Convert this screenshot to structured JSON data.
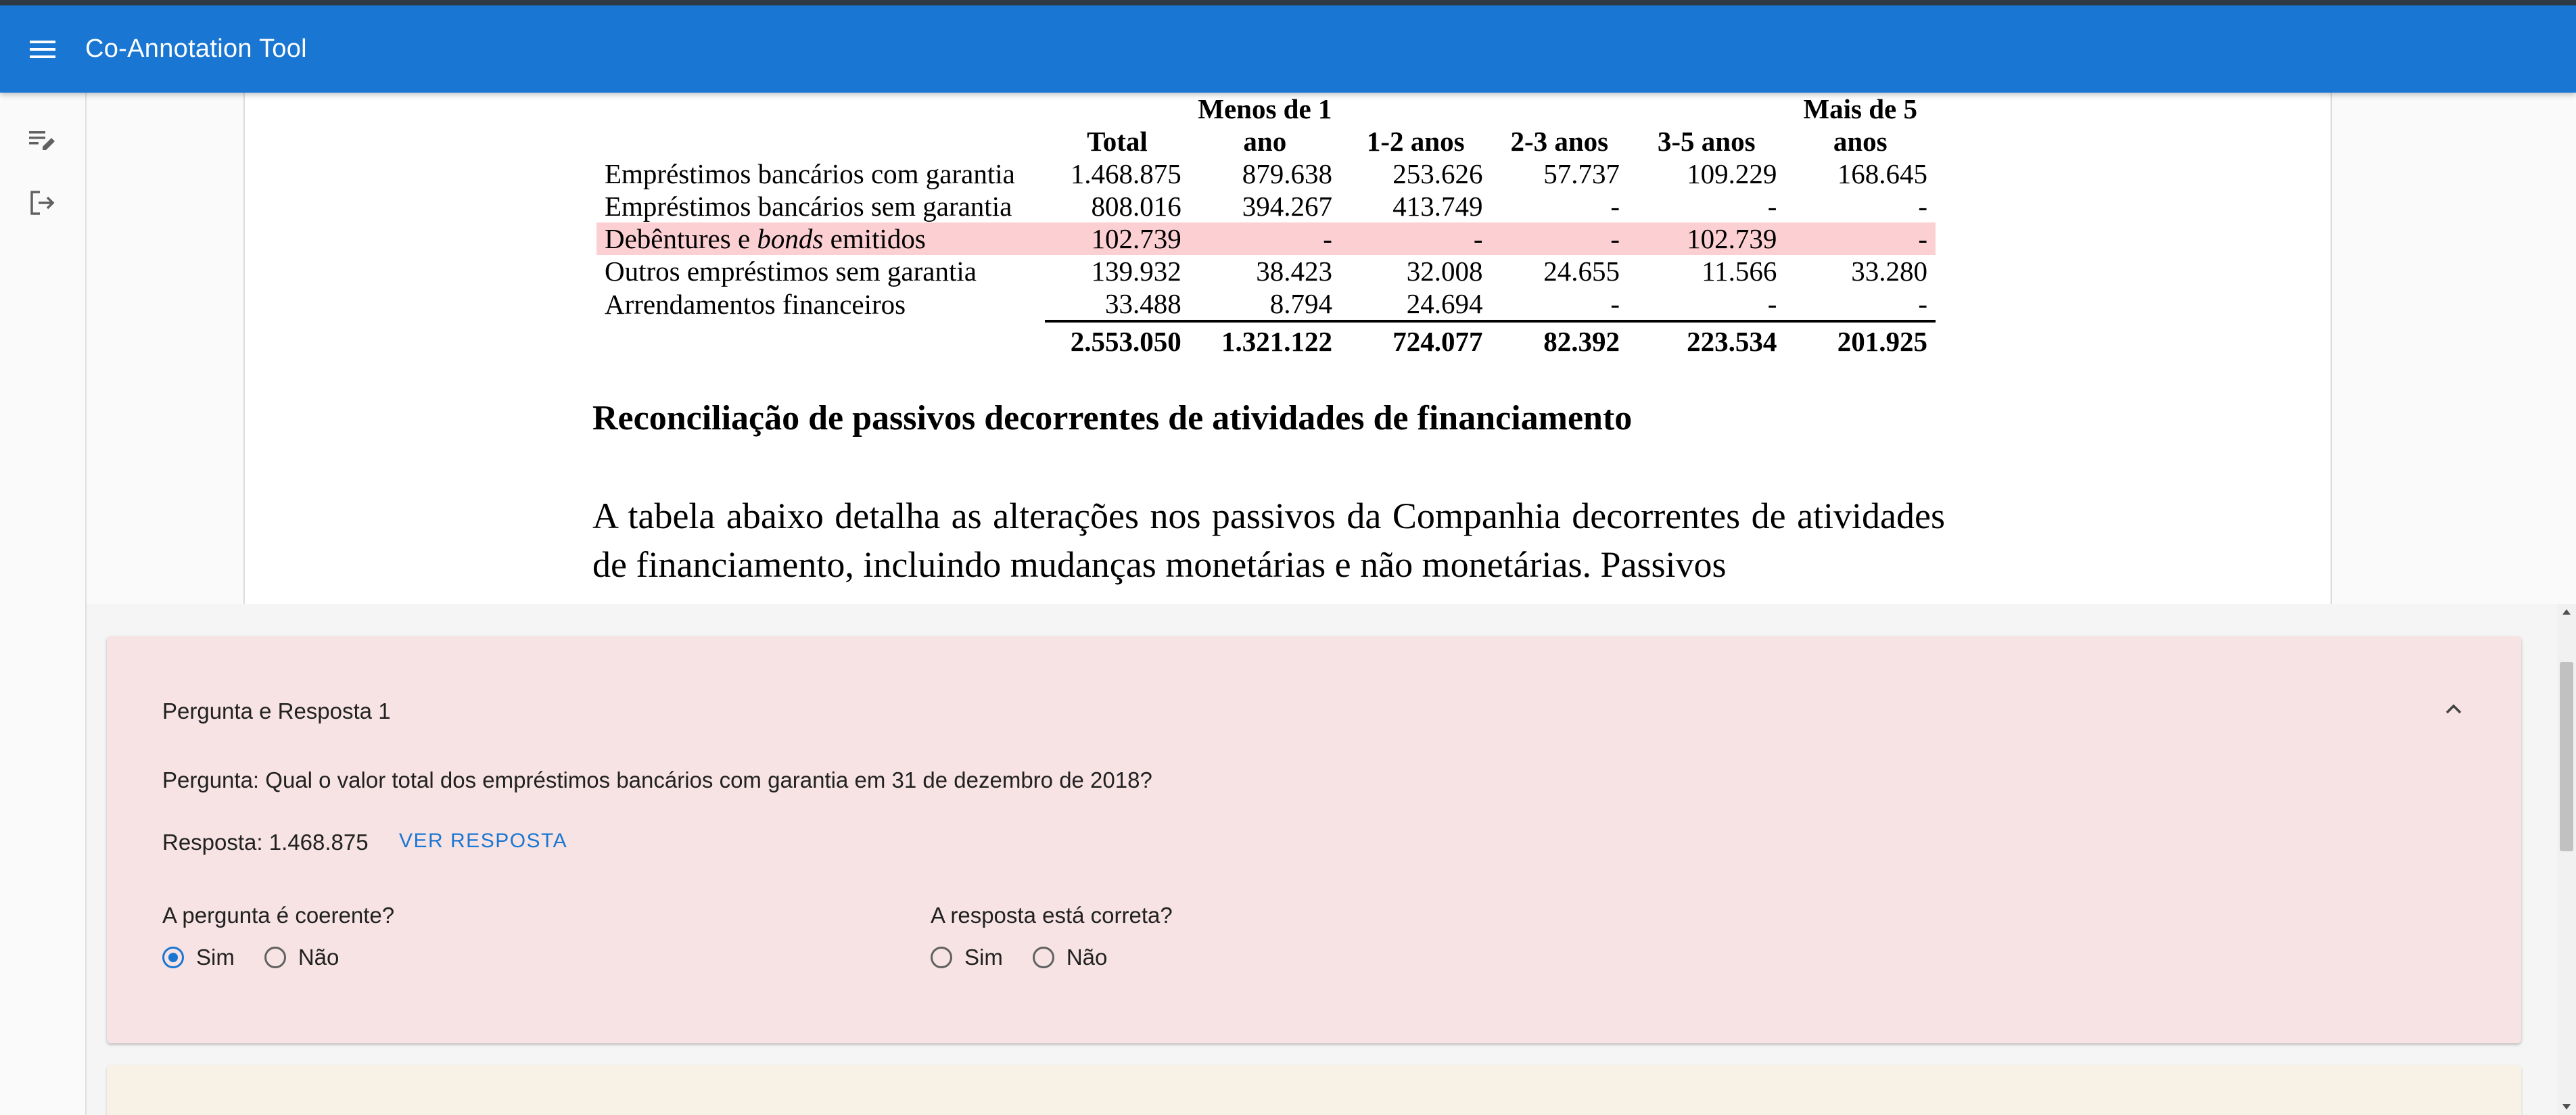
{
  "app": {
    "title": "Co-Annotation Tool"
  },
  "icons": {
    "menu": "menu-icon",
    "edit": "edit-list-icon",
    "logout": "logout-icon",
    "collapse": "chevron-up-icon"
  },
  "colors": {
    "appbar": "#1976d2",
    "highlight_row": "#fcd0d3",
    "card_bg": "#f7e3e4",
    "accent": "#1976d2"
  },
  "document": {
    "table": {
      "headers": [
        "",
        "Total",
        "Menos de 1 ano",
        "1-2 anos",
        "2-3 anos",
        "3-5 anos",
        "Mais de 5 anos"
      ],
      "rows": [
        {
          "label": "Empréstimos bancários com garantia",
          "values": [
            "1.468.875",
            "879.638",
            "253.626",
            "57.737",
            "109.229",
            "168.645"
          ]
        },
        {
          "label": "Empréstimos bancários sem garantia",
          "values": [
            "808.016",
            "394.267",
            "413.749",
            "-",
            "-",
            "-"
          ]
        },
        {
          "label_pre": "Debêntures e ",
          "label_em": "bonds",
          "label_post": " emitidos",
          "highlighted": true,
          "values": [
            "102.739",
            "-",
            "-",
            "-",
            "102.739",
            "-"
          ]
        },
        {
          "label": "Outros empréstimos sem garantia",
          "values": [
            "139.932",
            "38.423",
            "32.008",
            "24.655",
            "11.566",
            "33.280"
          ]
        },
        {
          "label": "Arrendamentos financeiros",
          "values": [
            "33.488",
            "8.794",
            "24.694",
            "-",
            "-",
            "-"
          ]
        }
      ],
      "totals": [
        "2.553.050",
        "1.321.122",
        "724.077",
        "82.392",
        "223.534",
        "201.925"
      ]
    },
    "section_heading": "Reconciliação de passivos decorrentes de atividades de financiamento",
    "paragraph": "A tabela abaixo detalha as alterações nos passivos da Companhia decorrentes de atividades de financiamento, incluindo mudanças monetárias e não monetárias. Passivos"
  },
  "qa": {
    "title": "Pergunta e Resposta 1",
    "question": "Pergunta: Qual o valor total dos empréstimos bancários com garantia em 31 de dezembro de 2018?",
    "answer": "Resposta: 1.468.875",
    "reveal_label": "VER RESPOSTA",
    "coherent": {
      "label": "A pergunta é coerente?",
      "options": [
        "Sim",
        "Não"
      ],
      "selected": "Sim"
    },
    "correct": {
      "label": "A resposta está correta?",
      "options": [
        "Sim",
        "Não"
      ],
      "selected": null
    }
  }
}
